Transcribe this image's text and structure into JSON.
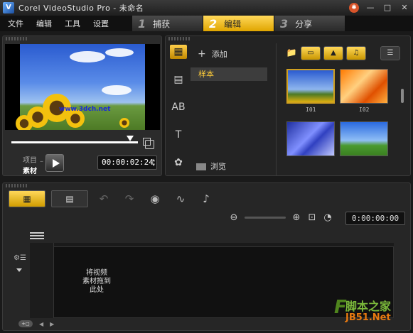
{
  "window": {
    "title": "Corel VideoStudio Pro - 未命名"
  },
  "menu": [
    "文件",
    "编辑",
    "工具",
    "设置"
  ],
  "steps": [
    {
      "num": "1",
      "label": "捕获",
      "active": false
    },
    {
      "num": "2",
      "label": "编辑",
      "active": true
    },
    {
      "num": "3",
      "label": "分享",
      "active": false
    }
  ],
  "preview": {
    "overlay_url": "www.3dch.net",
    "mode_project": "项目",
    "mode_clip": "素材",
    "timecode": "00:00:02:24"
  },
  "library": {
    "add_label": "添加",
    "sample_label": "样本",
    "browse_label": "浏览",
    "thumbnails": [
      {
        "label": "I01",
        "selected": true
      },
      {
        "label": "I02",
        "selected": false
      },
      {
        "label": "",
        "selected": false
      },
      {
        "label": "",
        "selected": false
      }
    ]
  },
  "timeline": {
    "timecode": "0:00:00:00",
    "drop_hint": "将视频\n素材拖到\n此处"
  },
  "watermark": {
    "cn": "脚本之家",
    "en": "JB51.Net"
  },
  "colors": {
    "accent": "#ffd85a",
    "sample_text": "#ffcd3a"
  }
}
